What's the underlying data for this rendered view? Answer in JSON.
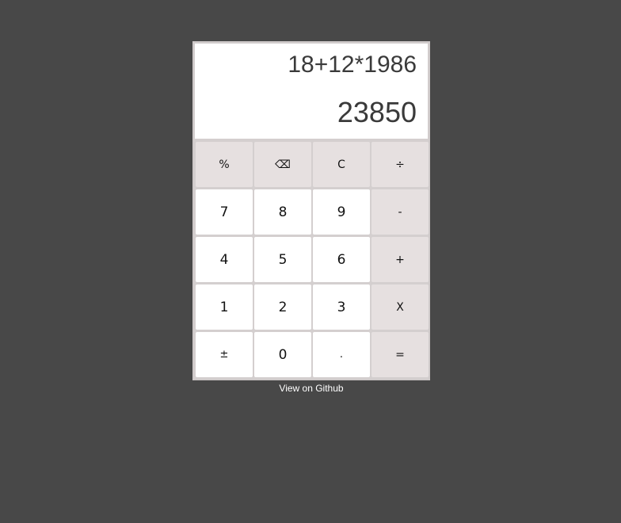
{
  "display": {
    "expression": "18+12*1986",
    "result": "23850"
  },
  "keys": [
    {
      "label": "%",
      "name": "percent-button",
      "type": "op"
    },
    {
      "label": "⌫",
      "name": "backspace-button",
      "type": "op"
    },
    {
      "label": "C",
      "name": "clear-button",
      "type": "op"
    },
    {
      "label": "÷",
      "name": "divide-button",
      "type": "op"
    },
    {
      "label": "7",
      "name": "digit-7-button",
      "type": "num"
    },
    {
      "label": "8",
      "name": "digit-8-button",
      "type": "num"
    },
    {
      "label": "9",
      "name": "digit-9-button",
      "type": "num"
    },
    {
      "label": "-",
      "name": "subtract-button",
      "type": "op"
    },
    {
      "label": "4",
      "name": "digit-4-button",
      "type": "num"
    },
    {
      "label": "5",
      "name": "digit-5-button",
      "type": "num"
    },
    {
      "label": "6",
      "name": "digit-6-button",
      "type": "num"
    },
    {
      "label": "+",
      "name": "add-button",
      "type": "op"
    },
    {
      "label": "1",
      "name": "digit-1-button",
      "type": "num"
    },
    {
      "label": "2",
      "name": "digit-2-button",
      "type": "num"
    },
    {
      "label": "3",
      "name": "digit-3-button",
      "type": "num"
    },
    {
      "label": "X",
      "name": "multiply-button",
      "type": "op"
    },
    {
      "label": "±",
      "name": "sign-toggle-button",
      "type": "num-small"
    },
    {
      "label": "0",
      "name": "digit-0-button",
      "type": "num"
    },
    {
      "label": ".",
      "name": "decimal-button",
      "type": "num-small"
    },
    {
      "label": "=",
      "name": "equals-button",
      "type": "op"
    }
  ],
  "footer": {
    "github_link": "View on Github"
  }
}
